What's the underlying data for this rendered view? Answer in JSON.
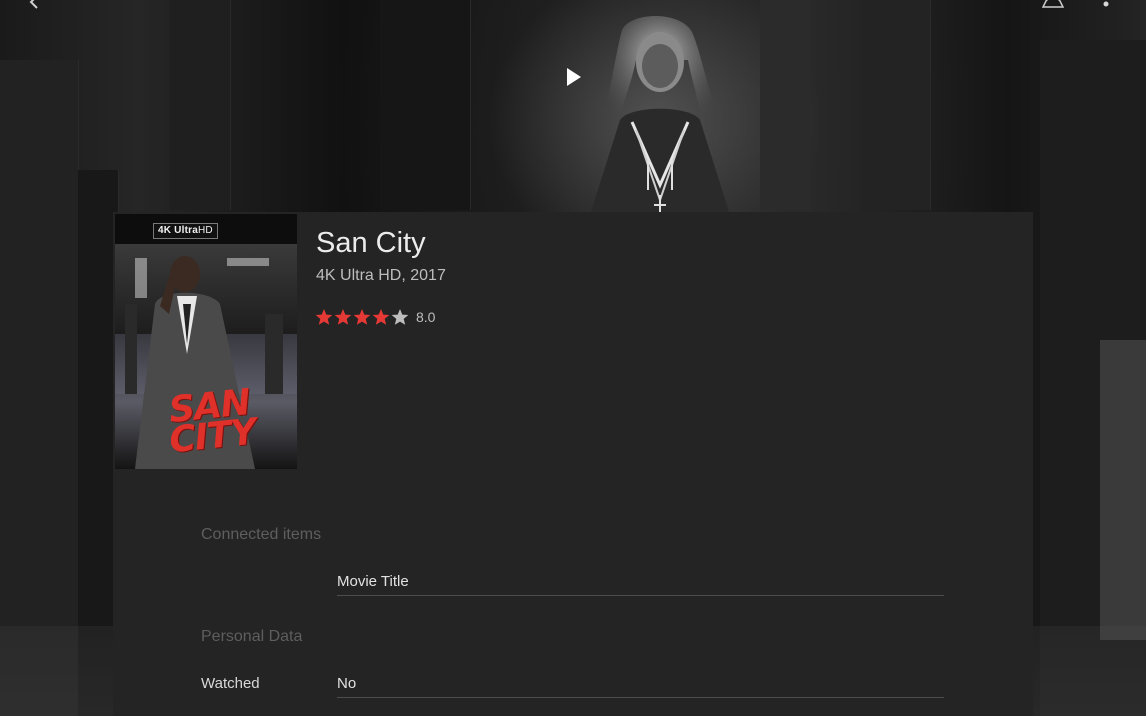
{
  "movie": {
    "title": "San City",
    "subtitle": "4K Ultra HD, 2017",
    "rating": {
      "value": "8.0",
      "stars_filled": 4,
      "stars_total": 5,
      "filled_color": "#e53935",
      "empty_color": "#bdbdbd"
    },
    "poster": {
      "badge_4k": "4K",
      "badge_ultra": "Ultra",
      "badge_hd": "HD",
      "art_title": "SAN CITY"
    }
  },
  "sections": {
    "connected": {
      "header": "Connected items",
      "rows": [
        {
          "label": "",
          "value": "Movie Title"
        }
      ]
    },
    "personal": {
      "header": "Personal Data",
      "rows": [
        {
          "label": "Watched",
          "value": "No"
        }
      ]
    }
  },
  "icons": {
    "back": "chevron-left-icon",
    "play": "play-icon",
    "profile": "person-icon",
    "more": "more-vertical-icon"
  },
  "colors": {
    "card_bg": "#242424",
    "accent_red": "#e53935"
  }
}
